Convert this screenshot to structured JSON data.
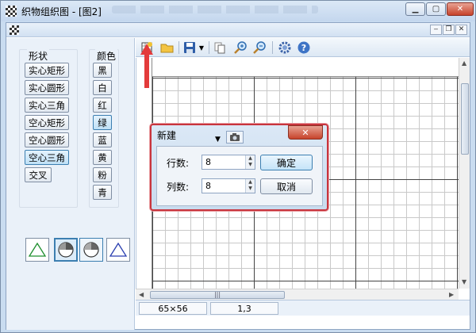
{
  "window": {
    "title": "织物组织图 - [图2]",
    "min_label": "▁",
    "max_label": "▢",
    "close_label": "✕"
  },
  "mdi": {
    "min_label": "‒",
    "restore_label": "❐",
    "close_label": "✕"
  },
  "shapes": {
    "title": "形状",
    "items": [
      "实心矩形",
      "实心圆形",
      "实心三角",
      "空心矩形",
      "空心圆形",
      "空心三角",
      "交叉"
    ],
    "selected": "空心三角"
  },
  "colors": {
    "title": "颜色",
    "items": [
      "黑",
      "白",
      "红",
      "绿",
      "蓝",
      "黄",
      "粉",
      "青"
    ],
    "selected": "绿"
  },
  "toolbar": {
    "icons": [
      "new-grid-icon",
      "open-folder-icon",
      "save-icon",
      "dropdown-icon",
      "copy-icon",
      "zoom-in-icon",
      "zoom-out-icon",
      "settings-gear-icon",
      "help-icon"
    ]
  },
  "status": {
    "size": "65×56",
    "position": "1,3"
  },
  "scroll": {
    "grip": "|||"
  },
  "dialog": {
    "title": "新建",
    "close_label": "✕",
    "rows_label": "行数:",
    "rows_value": "8",
    "cols_label": "列数:",
    "cols_value": "8",
    "ok_label": "确定",
    "cancel_label": "取消"
  },
  "accent_colors": {
    "selection": "#3c7fb1",
    "annotation_red": "#c8343d",
    "titlebar": "#c9dcf0"
  }
}
